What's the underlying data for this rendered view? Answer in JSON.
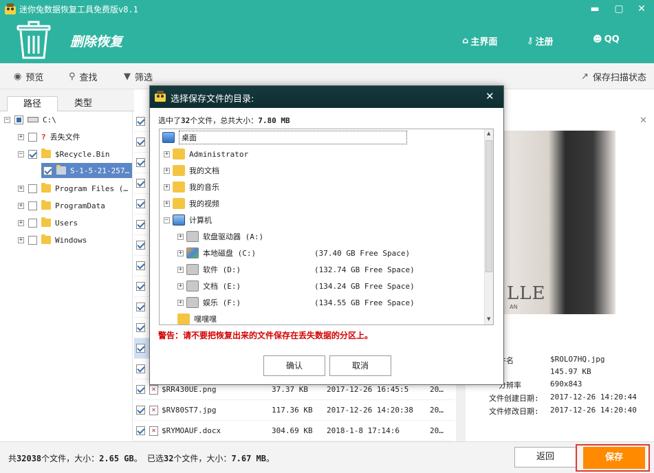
{
  "window": {
    "title": "迷你兔数据恢复工具免费版v8.1"
  },
  "header": {
    "title": "删除恢复",
    "nav": [
      {
        "label": "主界面",
        "icon": "home-icon"
      },
      {
        "label": "注册",
        "icon": "key-icon"
      },
      {
        "label": "QQ",
        "icon": "qq-icon"
      }
    ]
  },
  "toolbar": {
    "preview_label": "预览",
    "search_label": "查找",
    "filter_label": "筛选",
    "save_scan_label": "保存扫描状态"
  },
  "left_tabs": {
    "path": "路径",
    "type": "类型"
  },
  "tree": [
    {
      "label": "C:\\",
      "level": 0
    },
    {
      "label": "丢失文件",
      "level": 1
    },
    {
      "label": "$Recycle.Bin",
      "level": 1
    },
    {
      "label": "S-1-5-21-257…",
      "level": 2
    },
    {
      "label": "Program Files (…",
      "level": 1
    },
    {
      "label": "ProgramData",
      "level": 1
    },
    {
      "label": "Users",
      "level": 1
    },
    {
      "label": "Windows",
      "level": 1
    }
  ],
  "files": [
    {
      "name": "$RR430UE.png",
      "size": "37.37 KB",
      "date": "2017-12-26 16:45:5",
      "extra": "20…"
    },
    {
      "name": "$RV80ST7.jpg",
      "size": "117.36 KB",
      "date": "2017-12-26 14:20:38",
      "extra": "20…"
    },
    {
      "name": "$RYMOAUF.docx",
      "size": "304.69 KB",
      "date": "2018-1-8 17:14:6",
      "extra": "20…"
    }
  ],
  "preview_info": [
    {
      "label": "件名",
      "value": "$ROLO7HQ.jpg"
    },
    {
      "label": "",
      "value": "145.97 KB"
    },
    {
      "label": "分辨率",
      "value": "690x843"
    },
    {
      "label": "文件创建日期:",
      "value": "2017-12-26 14:20:44"
    },
    {
      "label": "文件修改日期:",
      "value": "2017-12-26 14:20:40"
    }
  ],
  "photo_text": "LLE",
  "photo_sub": "AN",
  "bottom": {
    "status_prefix": "共",
    "total_count": "32038",
    "status_mid1": "个文件，大小：",
    "total_size": "2.65 GB",
    "status_mid2": "。 已选",
    "selected_count": "32",
    "status_mid3": "个文件，大小：",
    "selected_size": "7.67 MB",
    "status_end": "。",
    "back_label": "返回",
    "save_label": "保存"
  },
  "dialog": {
    "title": "选择保存文件的目录:",
    "summary_prefix": "选中了",
    "summary_count": "32",
    "summary_mid": "个文件，总共大小：",
    "summary_size": "7.80 MB",
    "tree": [
      {
        "label": "桌面",
        "free": ""
      },
      {
        "label": "Administrator",
        "free": ""
      },
      {
        "label": "我的文档",
        "free": ""
      },
      {
        "label": "我的音乐",
        "free": ""
      },
      {
        "label": "我的视频",
        "free": ""
      },
      {
        "label": "计算机",
        "free": ""
      },
      {
        "label": "软盘驱动器 (A:)",
        "free": ""
      },
      {
        "label": "本地磁盘 (C:)",
        "free": "(37.40 GB Free Space)"
      },
      {
        "label": "软件 (D:)",
        "free": "(132.74 GB Free Space)"
      },
      {
        "label": "文档 (E:)",
        "free": "(134.24 GB Free Space)"
      },
      {
        "label": "娱乐 (F:)",
        "free": "(134.55 GB Free Space)"
      },
      {
        "label": "嘿嘿嘿",
        "free": ""
      }
    ],
    "warning": "警告：请不要把恢复出来的文件保存在丢失数据的分区上。",
    "ok_label": "确认",
    "cancel_label": "取消"
  },
  "colors": {
    "accent": "#2eb3a0",
    "save": "#ff8a00",
    "warning": "#d40000",
    "dialog_title": "#163a3e"
  }
}
